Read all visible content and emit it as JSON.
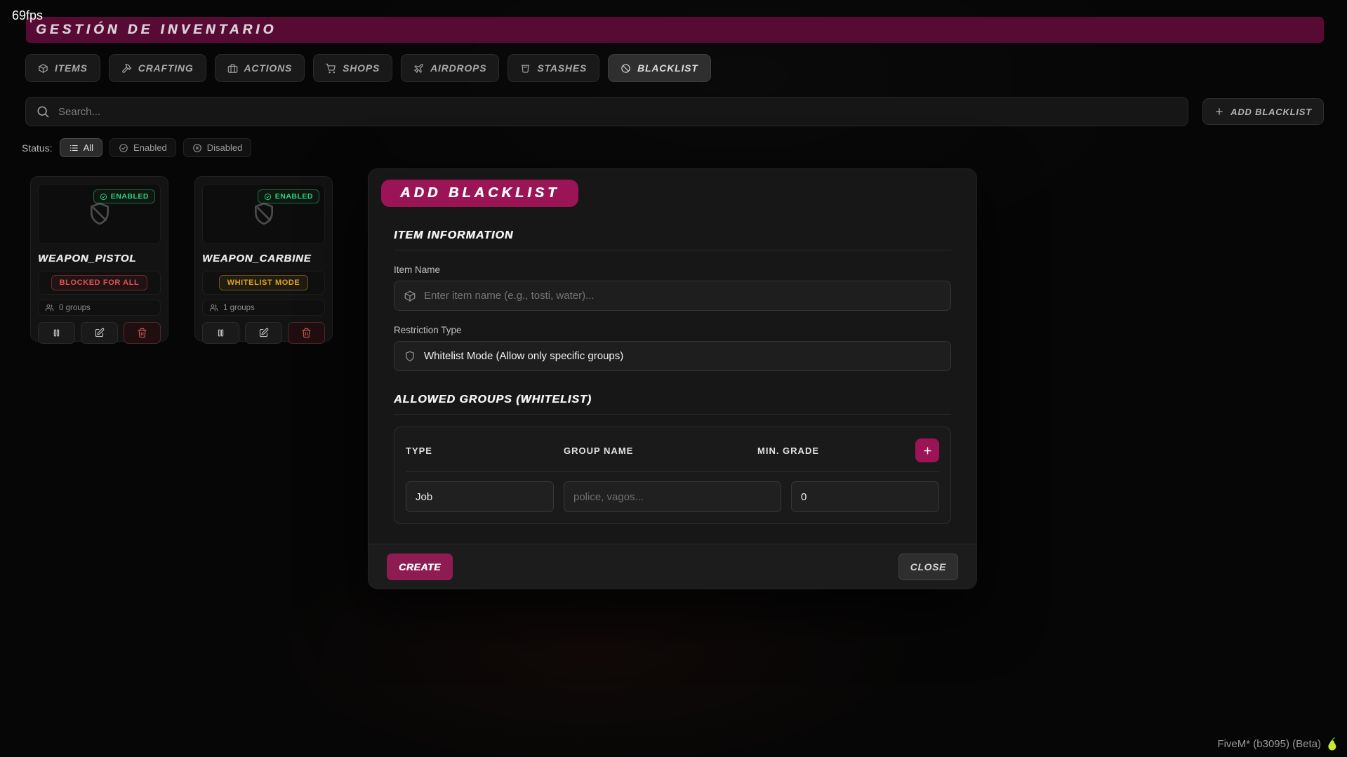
{
  "fps_counter": "69fps",
  "header": {
    "title": "GESTIÓN DE INVENTARIO"
  },
  "tabs": [
    {
      "label": "ITEMS",
      "icon": "package-icon",
      "active": false
    },
    {
      "label": "CRAFTING",
      "icon": "hammer-icon",
      "active": false
    },
    {
      "label": "ACTIONS",
      "icon": "briefcase-icon",
      "active": false
    },
    {
      "label": "SHOPS",
      "icon": "cart-icon",
      "active": false
    },
    {
      "label": "AIRDROPS",
      "icon": "plane-icon",
      "active": false
    },
    {
      "label": "STASHES",
      "icon": "stash-icon",
      "active": false
    },
    {
      "label": "BLACKLIST",
      "icon": "ban-icon",
      "active": true
    }
  ],
  "toolbar": {
    "search_placeholder": "Search...",
    "add_blacklist_label": "ADD BLACKLIST"
  },
  "status_filter": {
    "label": "Status:",
    "options": [
      {
        "label": "All",
        "icon": "list-icon",
        "active": true
      },
      {
        "label": "Enabled",
        "icon": "check-circle-icon",
        "active": false
      },
      {
        "label": "Disabled",
        "icon": "x-circle-icon",
        "active": false
      }
    ]
  },
  "cards": [
    {
      "name": "WEAPON_PISTOL",
      "status_badge": "ENABLED",
      "mode_badge": "BLOCKED FOR ALL",
      "mode_type": "blocked",
      "groups_count": "0 groups"
    },
    {
      "name": "WEAPON_CARBINE",
      "status_badge": "ENABLED",
      "mode_badge": "WHITELIST MODE",
      "mode_type": "whitelist",
      "groups_count": "1 groups"
    }
  ],
  "modal": {
    "title": "ADD BLACKLIST",
    "item_info_heading": "ITEM INFORMATION",
    "item_name_label": "Item Name",
    "item_name_placeholder": "Enter item name (e.g., tosti, water)...",
    "restriction_label": "Restriction Type",
    "restriction_value": "Whitelist Mode (Allow only specific groups)",
    "groups_heading": "ALLOWED GROUPS (WHITELIST)",
    "groups_table": {
      "headers": {
        "type": "TYPE",
        "group_name": "GROUP NAME",
        "min_grade": "MIN. GRADE"
      },
      "row": {
        "type_value": "Job",
        "group_placeholder": "police, vagos...",
        "min_grade_value": "0"
      }
    },
    "create_label": "CREATE",
    "close_label": "CLOSE"
  },
  "brand": {
    "text": "FiveM* (b3095) (Beta)"
  },
  "colors": {
    "header_bar": "#570a33",
    "accent_magenta": "#9b1456",
    "create_magenta": "#8e1b52",
    "enabled_green": "#35d07f",
    "blocked_red": "#e05252",
    "whitelist_amber": "#dfa321",
    "page_background": "#060606",
    "modal_background": "#171717"
  }
}
